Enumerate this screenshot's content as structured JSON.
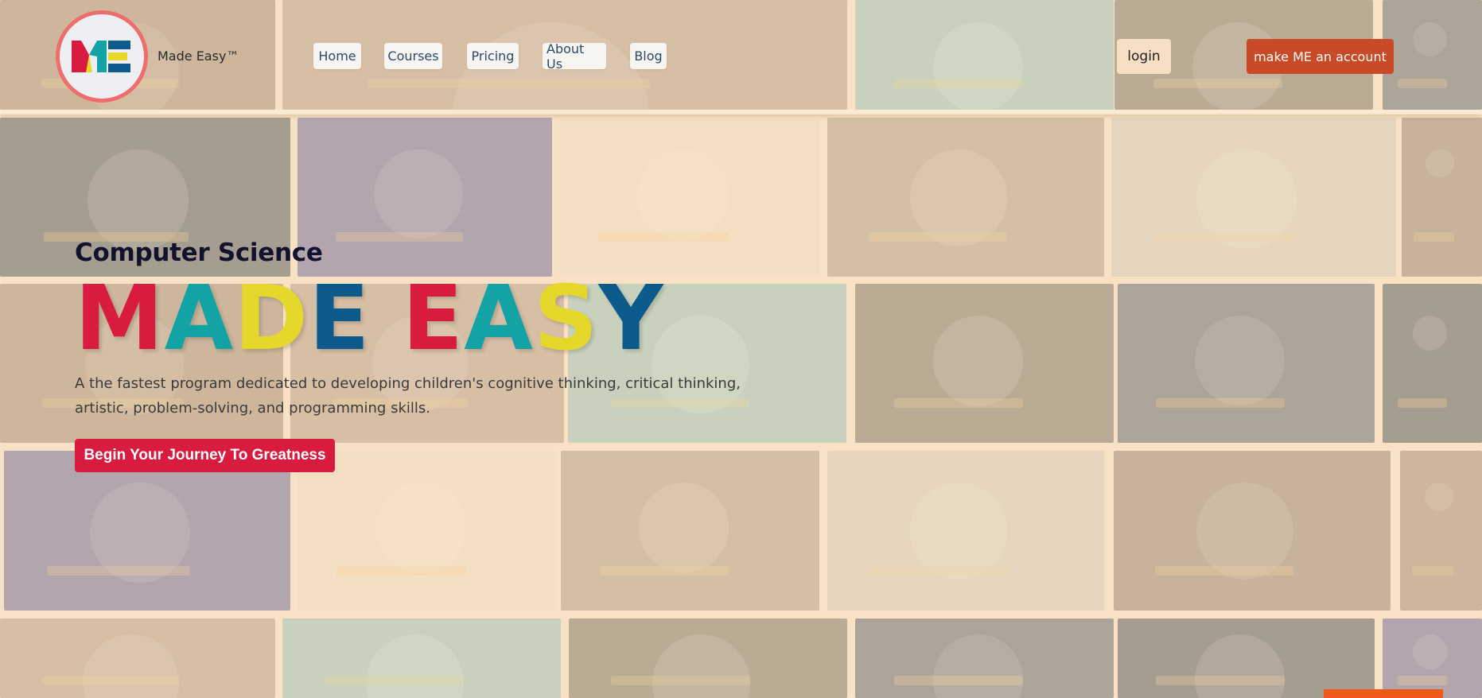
{
  "brand": {
    "logo_text": "ME",
    "name": "Made Easy™"
  },
  "nav": {
    "items": [
      {
        "label": "Home"
      },
      {
        "label": "Courses"
      },
      {
        "label": "Pricing"
      },
      {
        "label": "About Us"
      },
      {
        "label": "Blog"
      }
    ]
  },
  "auth": {
    "login_label": "login",
    "signup_label": "make ME an account"
  },
  "hero": {
    "subtitle": "Computer Science",
    "headline_letters": [
      {
        "char": "M",
        "color": "#d81b3e"
      },
      {
        "char": "A",
        "color": "#14a3a5"
      },
      {
        "char": "D",
        "color": "#e6d82a"
      },
      {
        "char": "E",
        "color": "#0d5a8c"
      },
      {
        "char": " ",
        "color": "#000000"
      },
      {
        "char": "E",
        "color": "#d81b3e"
      },
      {
        "char": "A",
        "color": "#14a3a5"
      },
      {
        "char": "S",
        "color": "#e6d82a"
      },
      {
        "char": "Y",
        "color": "#0d5a8c"
      }
    ],
    "description": "A the fastest program dedicated to developing children's cognitive thinking, critical thinking, artistic, problem-solving, and programming skills.",
    "cta_label": "Begin Your Journey To Greatness"
  },
  "colors": {
    "accent_red": "#d81b3e",
    "accent_teal": "#14a3a5",
    "accent_yellow": "#e6d82a",
    "accent_blue": "#0d5a8c",
    "signup_bg": "#c84a26",
    "background_tint": "#fde6c8"
  },
  "background_tiles": [
    {
      "subject": "3d-character-icon",
      "color": "#8a7560"
    },
    {
      "subject": "robot-icon",
      "color": "#a38a78"
    },
    {
      "subject": "phone-construction-icon",
      "color": "#7fb6ae"
    },
    {
      "subject": "game-grid-icon",
      "color": "#5e5e4e"
    },
    {
      "subject": "ai-brain-icon",
      "color": "#3c4b5a"
    },
    {
      "subject": "python-code-icon",
      "color": "#2f3a45"
    },
    {
      "subject": "laptop-holo-icon",
      "color": "#4a4d8a"
    },
    {
      "subject": "devices-illustration-icon",
      "color": "#e7d6bc"
    },
    {
      "subject": "classroom-photo-icon",
      "color": "#9a8d72"
    },
    {
      "subject": "kids-computer-photo-icon",
      "color": "#c7c2b4"
    },
    {
      "subject": "teacher-photo-icon",
      "color": "#7c6c5e"
    }
  ]
}
